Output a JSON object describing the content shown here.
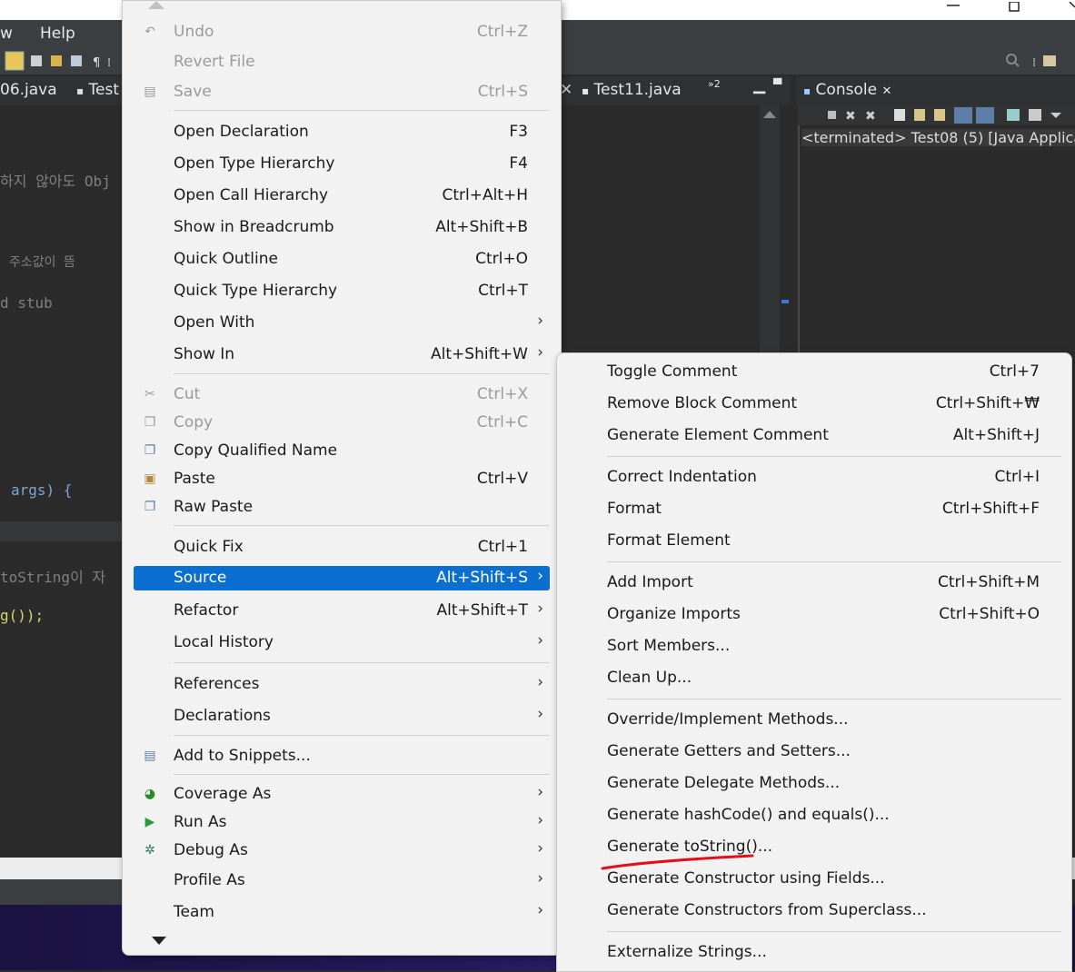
{
  "menubar": {
    "items": [
      "w",
      "Help"
    ]
  },
  "editor_tabs": {
    "left": [
      "06.java",
      "Test"
    ],
    "middle": "Test11.java",
    "overflow": "»2"
  },
  "console": {
    "tab_label": "Console",
    "status": "<terminated> Test08 (5) [Java Applica"
  },
  "code_lines": [
    "하지 않아도 Obj",
    "주소값이 뜸",
    "d stub",
    "args) {",
    "toString이 자",
    "g());"
  ],
  "context_menu": {
    "items": [
      {
        "label": "Undo",
        "shortcut": "Ctrl+Z",
        "disabled": true,
        "icon": "undo-icon"
      },
      {
        "label": "Revert File",
        "shortcut": "",
        "disabled": true
      },
      {
        "label": "Save",
        "shortcut": "Ctrl+S",
        "disabled": true,
        "icon": "save-icon"
      },
      {
        "label": "Open Declaration",
        "shortcut": "F3"
      },
      {
        "label": "Open Type Hierarchy",
        "shortcut": "F4"
      },
      {
        "label": "Open Call Hierarchy",
        "shortcut": "Ctrl+Alt+H"
      },
      {
        "label": "Show in Breadcrumb",
        "shortcut": "Alt+Shift+B"
      },
      {
        "label": "Quick Outline",
        "shortcut": "Ctrl+O"
      },
      {
        "label": "Quick Type Hierarchy",
        "shortcut": "Ctrl+T"
      },
      {
        "label": "Open With",
        "shortcut": "",
        "submenu": true
      },
      {
        "label": "Show In",
        "shortcut": "Alt+Shift+W",
        "submenu": true
      },
      {
        "label": "Cut",
        "shortcut": "Ctrl+X",
        "disabled": true,
        "icon": "cut-icon"
      },
      {
        "label": "Copy",
        "shortcut": "Ctrl+C",
        "disabled": true,
        "icon": "copy-icon"
      },
      {
        "label": "Copy Qualified Name",
        "shortcut": "",
        "icon": "copy-qualified-icon"
      },
      {
        "label": "Paste",
        "shortcut": "Ctrl+V",
        "icon": "paste-icon"
      },
      {
        "label": "Raw Paste",
        "shortcut": "",
        "icon": "raw-paste-icon"
      },
      {
        "label": "Quick Fix",
        "shortcut": "Ctrl+1"
      },
      {
        "label": "Source",
        "shortcut": "Alt+Shift+S",
        "submenu": true,
        "selected": true
      },
      {
        "label": "Refactor",
        "shortcut": "Alt+Shift+T",
        "submenu": true
      },
      {
        "label": "Local History",
        "shortcut": "",
        "submenu": true
      },
      {
        "label": "References",
        "shortcut": "",
        "submenu": true
      },
      {
        "label": "Declarations",
        "shortcut": "",
        "submenu": true
      },
      {
        "label": "Add to Snippets...",
        "shortcut": "",
        "icon": "snippets-icon"
      },
      {
        "label": "Coverage As",
        "shortcut": "",
        "submenu": true,
        "icon": "coverage-icon"
      },
      {
        "label": "Run As",
        "shortcut": "",
        "submenu": true,
        "icon": "run-icon"
      },
      {
        "label": "Debug As",
        "shortcut": "",
        "submenu": true,
        "icon": "debug-icon"
      },
      {
        "label": "Profile As",
        "shortcut": "",
        "submenu": true
      },
      {
        "label": "Team",
        "shortcut": "",
        "submenu": true
      }
    ]
  },
  "source_submenu": {
    "items": [
      {
        "label": "Toggle Comment",
        "shortcut": "Ctrl+7"
      },
      {
        "label": "Remove Block Comment",
        "shortcut": "Ctrl+Shift+₩"
      },
      {
        "label": "Generate Element Comment",
        "shortcut": "Alt+Shift+J"
      },
      {
        "label": "Correct Indentation",
        "shortcut": "Ctrl+I"
      },
      {
        "label": "Format",
        "shortcut": "Ctrl+Shift+F"
      },
      {
        "label": "Format Element",
        "shortcut": ""
      },
      {
        "label": "Add Import",
        "shortcut": "Ctrl+Shift+M"
      },
      {
        "label": "Organize Imports",
        "shortcut": "Ctrl+Shift+O"
      },
      {
        "label": "Sort Members...",
        "shortcut": ""
      },
      {
        "label": "Clean Up...",
        "shortcut": ""
      },
      {
        "label": "Override/Implement Methods...",
        "shortcut": ""
      },
      {
        "label": "Generate Getters and Setters...",
        "shortcut": ""
      },
      {
        "label": "Generate Delegate Methods...",
        "shortcut": ""
      },
      {
        "label": "Generate hashCode() and equals()...",
        "shortcut": ""
      },
      {
        "label": "Generate toString()...",
        "shortcut": "",
        "annotated": true
      },
      {
        "label": "Generate Constructor using Fields...",
        "shortcut": ""
      },
      {
        "label": "Generate Constructors from Superclass...",
        "shortcut": ""
      },
      {
        "label": "Externalize Strings...",
        "shortcut": ""
      }
    ]
  },
  "colors": {
    "selection": "#0a6fd1",
    "annotation": "#e0101a",
    "menu_bg": "#f2f2f2",
    "ide_dark": "#2b2b2b"
  }
}
